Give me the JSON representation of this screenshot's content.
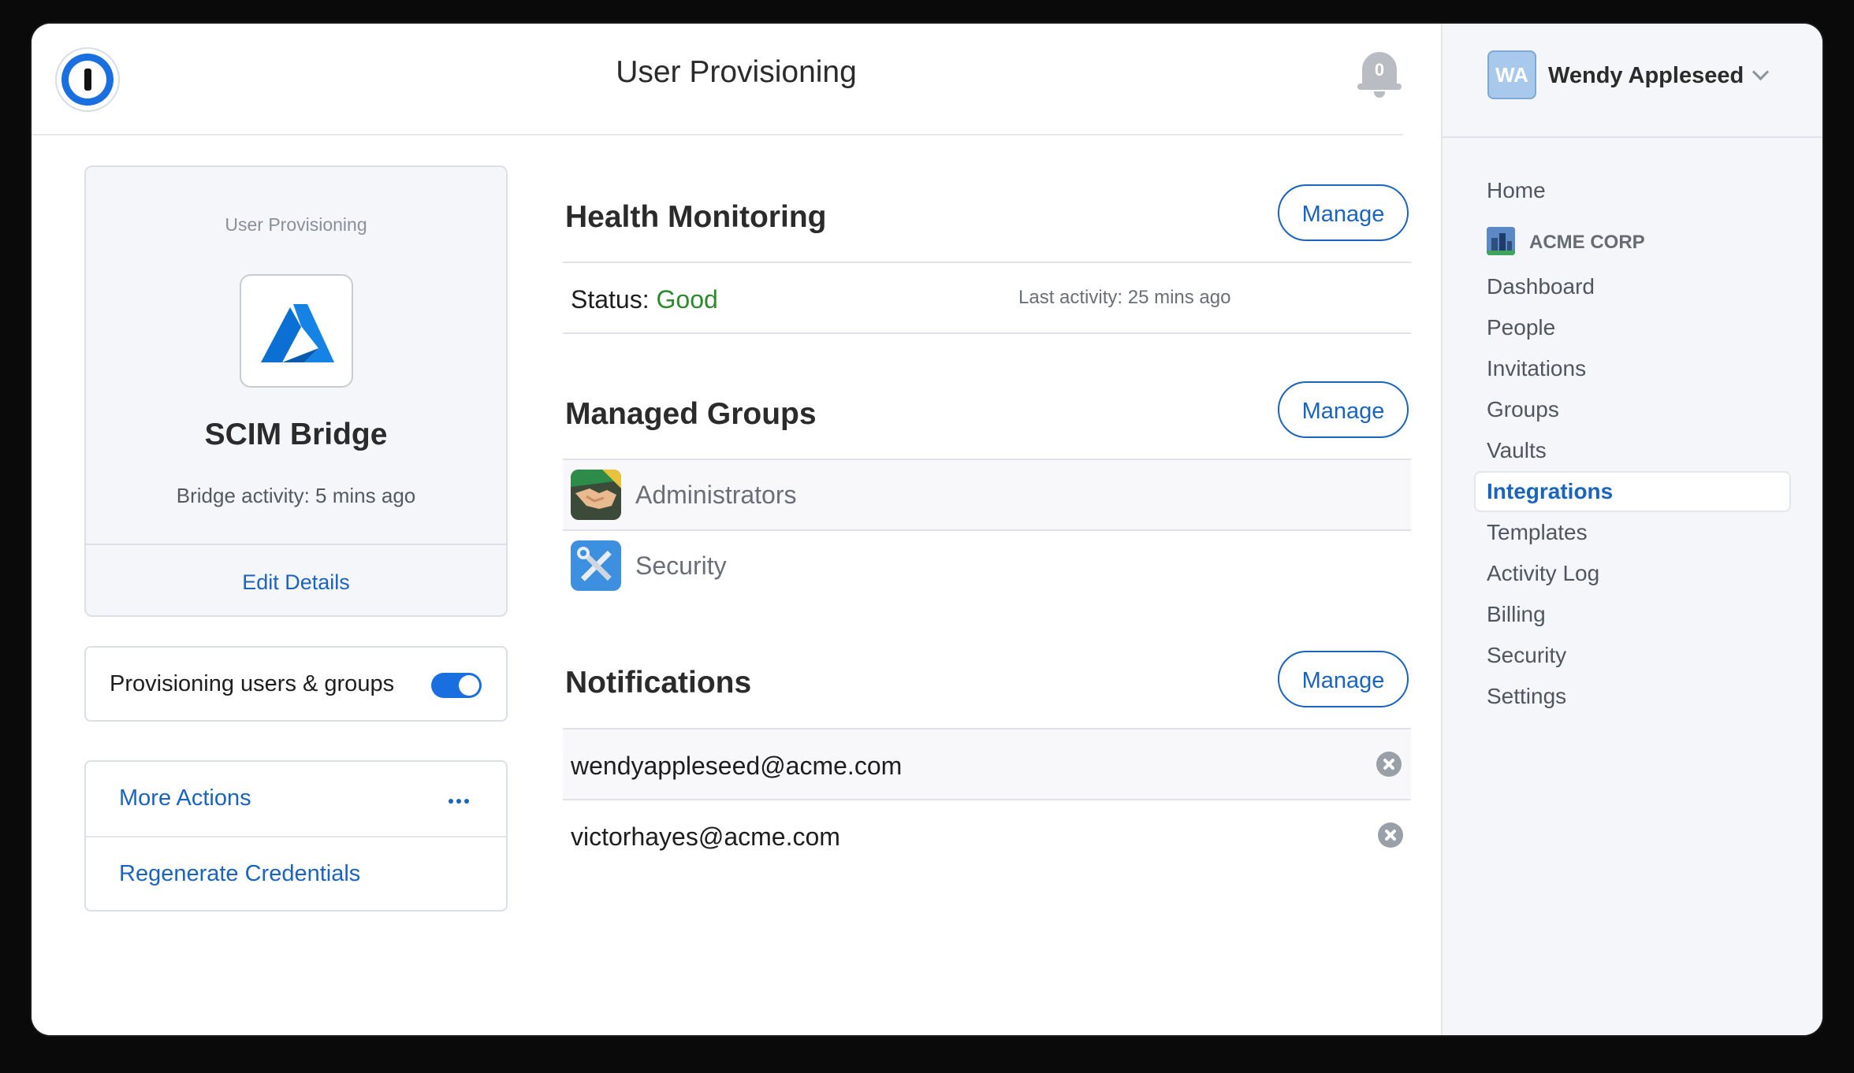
{
  "header": {
    "title": "User Provisioning",
    "notification_count": "0"
  },
  "bridge_card": {
    "label": "User Provisioning",
    "title": "SCIM Bridge",
    "activity": "Bridge activity: 5 mins ago",
    "edit_link": "Edit Details"
  },
  "provisioning_toggle": {
    "label": "Provisioning users & groups",
    "enabled": true
  },
  "actions": {
    "more_actions": "More Actions",
    "regenerate": "Regenerate Credentials"
  },
  "health": {
    "title": "Health Monitoring",
    "manage_label": "Manage",
    "status_label": "Status:",
    "status_value": "Good",
    "last_activity": "Last activity: 25 mins ago"
  },
  "groups": {
    "title": "Managed Groups",
    "manage_label": "Manage",
    "items": [
      {
        "name": "Administrators",
        "icon": "handshake-icon"
      },
      {
        "name": "Security",
        "icon": "tools-icon"
      }
    ]
  },
  "notifications": {
    "title": "Notifications",
    "manage_label": "Manage",
    "emails": [
      "wendyappleseed@acme.com",
      "victorhayes@acme.com"
    ]
  },
  "sidebar": {
    "user_initials": "WA",
    "user_name": "Wendy Appleseed",
    "org": "ACME CORP",
    "items": [
      {
        "label": "Home"
      },
      {
        "label": "Dashboard"
      },
      {
        "label": "People"
      },
      {
        "label": "Invitations"
      },
      {
        "label": "Groups"
      },
      {
        "label": "Vaults"
      },
      {
        "label": "Integrations",
        "active": true
      },
      {
        "label": "Templates"
      },
      {
        "label": "Activity Log"
      },
      {
        "label": "Billing"
      },
      {
        "label": "Security"
      },
      {
        "label": "Settings"
      }
    ]
  },
  "colors": {
    "accent": "#1a64c0",
    "status_good": "#2c8a2c",
    "toggle_on": "#1a6fe0"
  }
}
